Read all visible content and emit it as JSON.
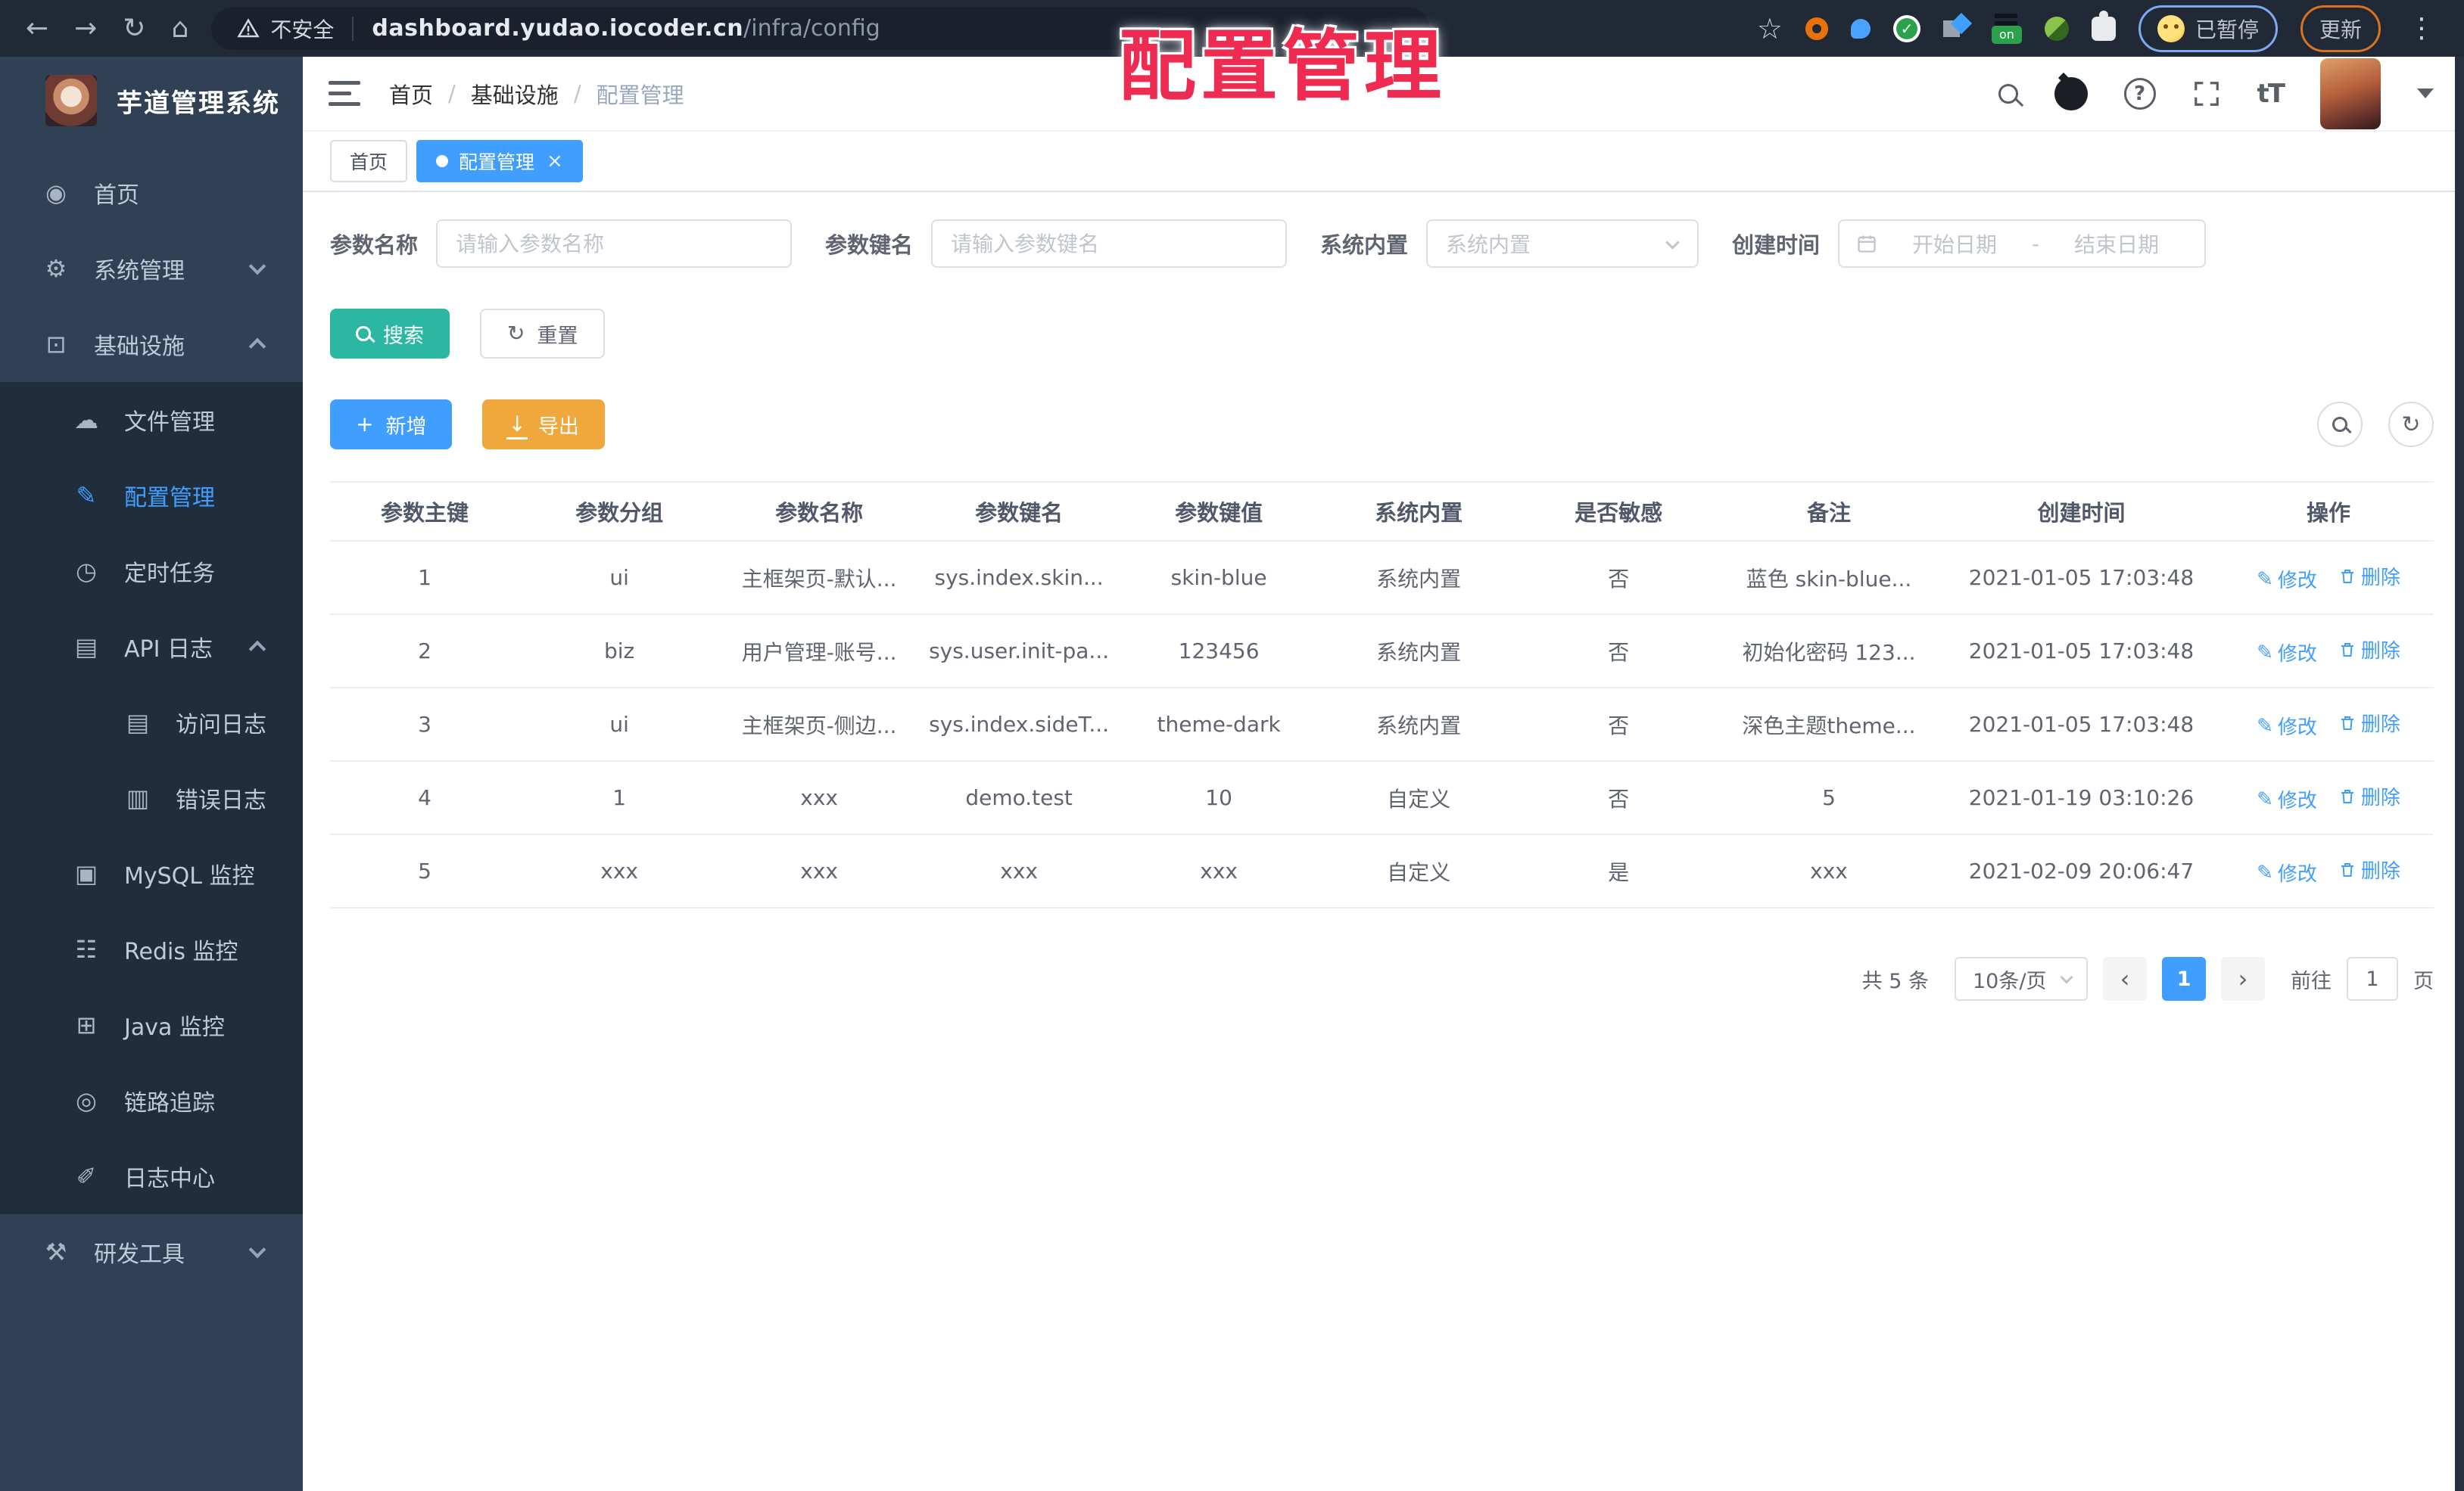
{
  "browser": {
    "security_label": "不安全",
    "url_host": "dashboard.yudao.iocoder.cn",
    "url_path": "/infra/config",
    "paused_chip": "已暂停",
    "update_chip": "更新"
  },
  "overlay": {
    "title": "配置管理"
  },
  "sidebar": {
    "app_title": "芋道管理系统",
    "items": [
      {
        "name": "home",
        "glyph": "◉",
        "label": "首页",
        "indent": 0,
        "active": false,
        "chevron": null
      },
      {
        "name": "system-management",
        "glyph": "⚙",
        "label": "系统管理",
        "indent": 0,
        "active": false,
        "chevron": "down"
      },
      {
        "name": "infrastructure",
        "glyph": "⊡",
        "label": "基础设施",
        "indent": 0,
        "active": false,
        "chevron": "up"
      },
      {
        "name": "file-management",
        "glyph": "☁",
        "label": "文件管理",
        "indent": 1,
        "active": false,
        "chevron": null
      },
      {
        "name": "config-management",
        "glyph": "✎",
        "label": "配置管理",
        "indent": 1,
        "active": true,
        "chevron": null
      },
      {
        "name": "scheduled-tasks",
        "glyph": "◷",
        "label": "定时任务",
        "indent": 1,
        "active": false,
        "chevron": null
      },
      {
        "name": "api-logs",
        "glyph": "▤",
        "label": "API 日志",
        "indent": 1,
        "active": false,
        "chevron": "up"
      },
      {
        "name": "access-logs",
        "glyph": "▤",
        "label": "访问日志",
        "indent": 2,
        "active": false,
        "chevron": null
      },
      {
        "name": "error-logs",
        "glyph": "▥",
        "label": "错误日志",
        "indent": 2,
        "active": false,
        "chevron": null
      },
      {
        "name": "mysql-monitor",
        "glyph": "▣",
        "label": "MySQL 监控",
        "indent": 1,
        "active": false,
        "chevron": null
      },
      {
        "name": "redis-monitor",
        "glyph": "☷",
        "label": "Redis 监控",
        "indent": 1,
        "active": false,
        "chevron": null
      },
      {
        "name": "java-monitor",
        "glyph": "⊞",
        "label": "Java 监控",
        "indent": 1,
        "active": false,
        "chevron": null
      },
      {
        "name": "trace",
        "glyph": "◎",
        "label": "链路追踪",
        "indent": 1,
        "active": false,
        "chevron": null
      },
      {
        "name": "log-center",
        "glyph": "✐",
        "label": "日志中心",
        "indent": 1,
        "active": false,
        "chevron": null
      },
      {
        "name": "dev-tools",
        "glyph": "⚒",
        "label": "研发工具",
        "indent": 0,
        "active": false,
        "chevron": "down"
      }
    ]
  },
  "header": {
    "breadcrumb": [
      "首页",
      "基础设施",
      "配置管理"
    ],
    "breadcrumb_separator": "/",
    "font_icon_label": "tT"
  },
  "tabs": [
    {
      "label": "首页",
      "active": false
    },
    {
      "label": "配置管理",
      "active": true,
      "close_label": "×"
    }
  ],
  "filters": {
    "name_label": "参数名称",
    "name_placeholder": "请输入参数名称",
    "key_label": "参数键名",
    "key_placeholder": "请输入参数键名",
    "type_label": "系统内置",
    "type_placeholder": "系统内置",
    "date_label": "创建时间",
    "date_start": "开始日期",
    "date_separator": "-",
    "date_end": "结束日期"
  },
  "toolbar": {
    "search": "搜索",
    "reset": "重置",
    "add": "新增",
    "export": "导出"
  },
  "table": {
    "columns": [
      "参数主键",
      "参数分组",
      "参数名称",
      "参数键名",
      "参数键值",
      "系统内置",
      "是否敏感",
      "备注",
      "创建时间",
      "操作"
    ],
    "rows": [
      [
        "1",
        "ui",
        "主框架页-默认...",
        "sys.index.skin...",
        "skin-blue",
        "系统内置",
        "否",
        "蓝色 skin-blue...",
        "2021-01-05 17:03:48"
      ],
      [
        "2",
        "biz",
        "用户管理-账号...",
        "sys.user.init-pa...",
        "123456",
        "系统内置",
        "否",
        "初始化密码 123...",
        "2021-01-05 17:03:48"
      ],
      [
        "3",
        "ui",
        "主框架页-侧边...",
        "sys.index.sideT...",
        "theme-dark",
        "系统内置",
        "否",
        "深色主题theme...",
        "2021-01-05 17:03:48"
      ],
      [
        "4",
        "1",
        "xxx",
        "demo.test",
        "10",
        "自定义",
        "否",
        "5",
        "2021-01-19 03:10:26"
      ],
      [
        "5",
        "xxx",
        "xxx",
        "xxx",
        "xxx",
        "自定义",
        "是",
        "xxx",
        "2021-02-09 20:06:47"
      ]
    ],
    "actions": {
      "edit": "修改",
      "delete": "删除"
    }
  },
  "pagination": {
    "total": "共 5 条",
    "page_size": "10条/页",
    "prev": "‹",
    "current_page": "1",
    "next": "›",
    "goto_label": "前往",
    "goto_value": "1",
    "page_unit": "页"
  },
  "colors": {
    "accent": "#409eff",
    "teal": "#2bb7a2",
    "amber": "#f0a73c",
    "sidebar": "#304156",
    "submenu": "#1f2d3d",
    "overlay_red": "#ee2b50"
  }
}
